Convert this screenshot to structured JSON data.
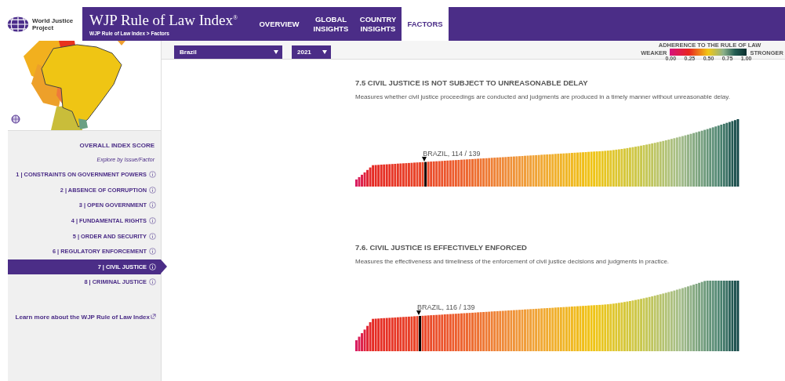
{
  "logo": {
    "name": "World Justice Project"
  },
  "header": {
    "title": "WJP Rule of Law Index$^{®}$",
    "breadcrumb": "WJP Rule of Law Index > Factors"
  },
  "tabs": [
    {
      "label": "OVERVIEW",
      "selected": false
    },
    {
      "label": "GLOBAL INSIGHTS",
      "selected": false
    },
    {
      "label": "COUNTRY INSIGHTS",
      "selected": false
    },
    {
      "label": "FACTORS",
      "selected": true
    }
  ],
  "filters": {
    "country": "Brazil",
    "year": "2021"
  },
  "legend": {
    "title": "ADHERENCE TO THE RULE OF LAW",
    "low": "WEAKER",
    "high": "STRONGER",
    "ticks": [
      "0.00",
      "0.25",
      "0.50",
      "0.75",
      "1.00"
    ]
  },
  "sidebar": {
    "overall": "OVERALL INDEX SCORE",
    "subtitle": "Explore by Issue/Factor",
    "items": [
      {
        "label": "1 | CONSTRAINTS ON GOVERNMENT POWERS",
        "selected": false
      },
      {
        "label": "2 | ABSENCE OF CORRUPTION",
        "selected": false
      },
      {
        "label": "3 | OPEN GOVERNMENT",
        "selected": false
      },
      {
        "label": "4 | FUNDAMENTAL RIGHTS",
        "selected": false
      },
      {
        "label": "5 | ORDER AND SECURITY",
        "selected": false
      },
      {
        "label": "6 | REGULATORY ENFORCEMENT",
        "selected": false
      },
      {
        "label": "7 | CIVIL JUSTICE",
        "selected": true
      },
      {
        "label": "8 | CRIMINAL JUSTICE",
        "selected": false
      }
    ],
    "learn_more": "Learn more about the WJP Rule of Law Index"
  },
  "sections": [
    {
      "title": "7.5 CIVIL JUSTICE IS NOT SUBJECT TO UNREASONABLE DELAY",
      "description": "Measures whether civil justice proceedings are conducted and judgments are produced in a timely manner without unreasonable delay.",
      "marker": {
        "label": "BRAZIL, 114 / 139"
      }
    },
    {
      "title": "7.6. CIVIL JUSTICE IS EFFECTIVELY ENFORCED",
      "description": "Measures the effectiveness and timeliness of the enforcement of civil justice decisions and judgments in practice.",
      "marker": {
        "label": "BRAZIL, 116 / 139"
      }
    }
  ]
}
